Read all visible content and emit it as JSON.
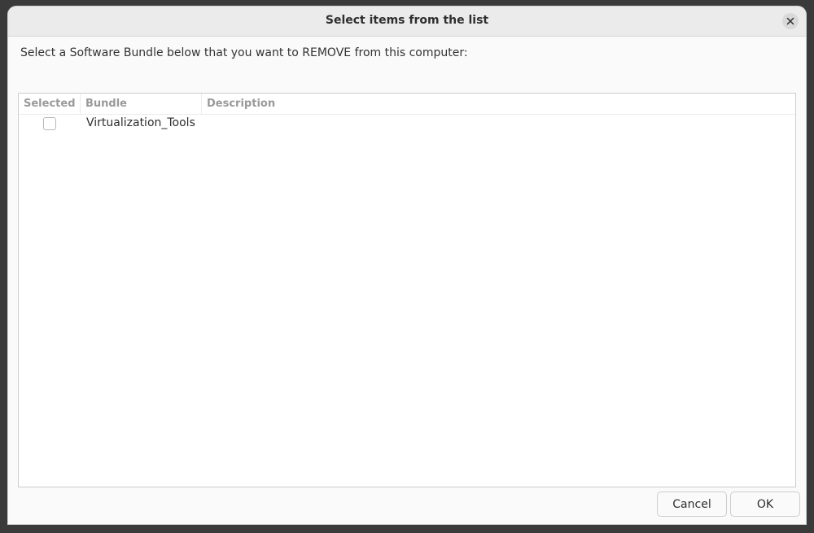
{
  "window": {
    "title": "Select items from the list",
    "close_icon": "close-icon"
  },
  "prompt": "Select a Software Bundle below that you want to REMOVE from this computer:",
  "list": {
    "columns": [
      "Selected",
      "Bundle",
      "Description"
    ],
    "rows": [
      {
        "selected": false,
        "bundle": "Virtualization_Tools",
        "description": ""
      }
    ]
  },
  "buttons": {
    "cancel": "Cancel",
    "ok": "OK"
  },
  "colors": {
    "window_bg": "#fafafa",
    "titlebar_bg": "#ebebeb",
    "header_text": "#9a9a9a",
    "text": "#2e2e2e"
  }
}
